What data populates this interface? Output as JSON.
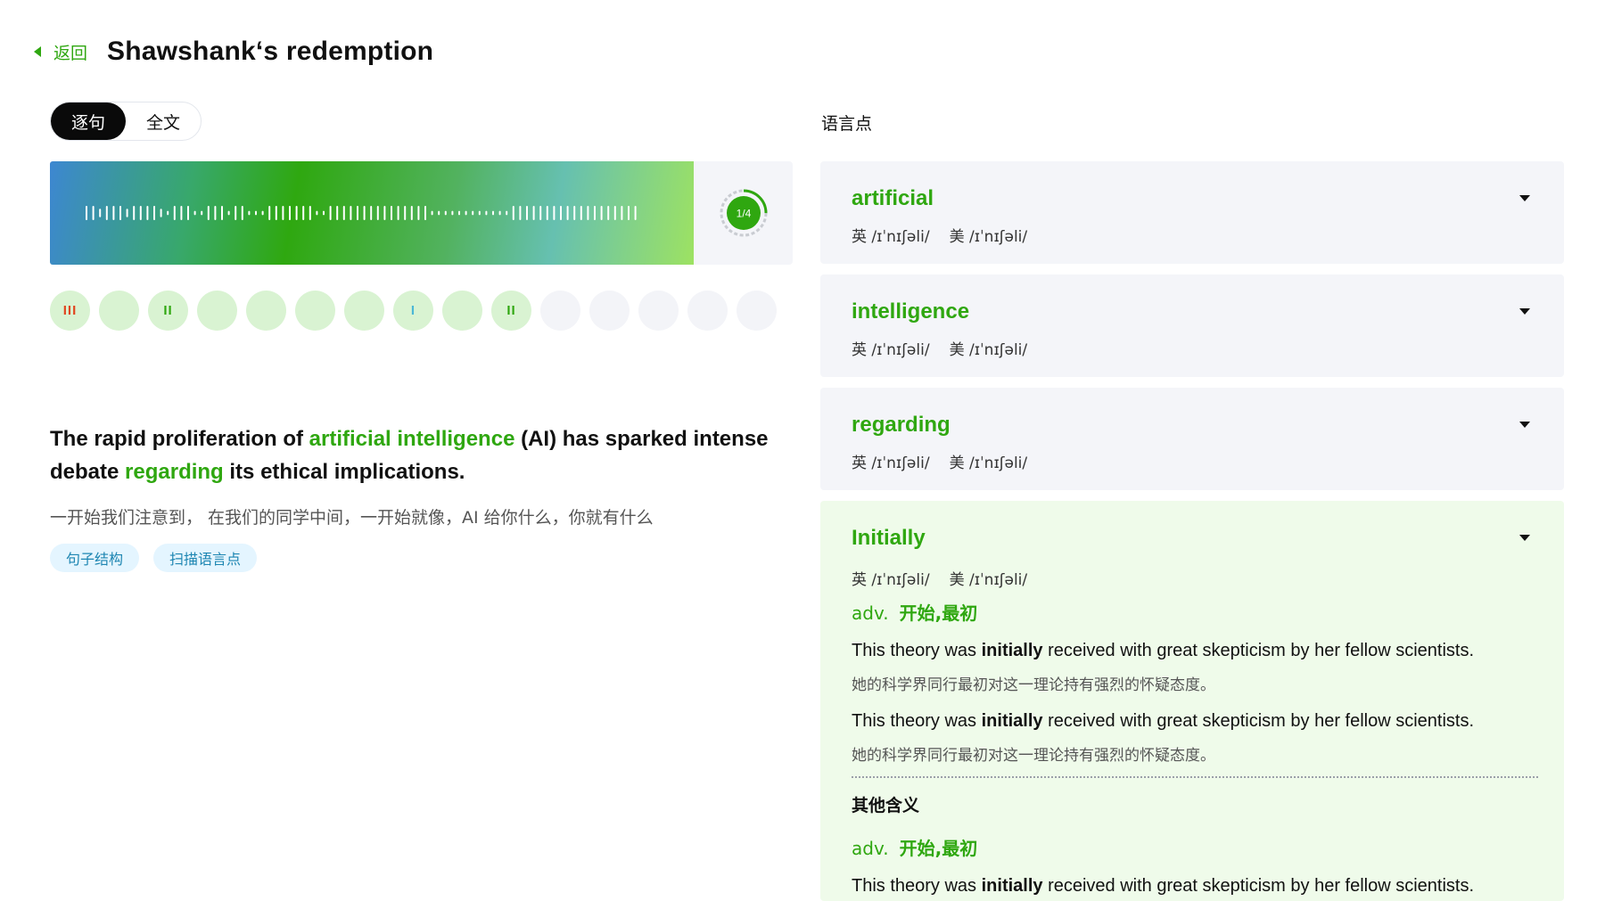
{
  "header": {
    "back_label": "返回",
    "title": "Shawshank‘s redemption"
  },
  "mode_toggle": {
    "options": [
      "逐句",
      "全文"
    ],
    "selected": "逐句"
  },
  "audio": {
    "progress_label": "1/4",
    "progress": 0.25
  },
  "sentence_dots": [
    {
      "state": "filled",
      "mark": "III",
      "color": "#e0451e"
    },
    {
      "state": "filled",
      "mark": "",
      "color": ""
    },
    {
      "state": "filled",
      "mark": "II",
      "color": "#2fa710"
    },
    {
      "state": "filled",
      "mark": "",
      "color": ""
    },
    {
      "state": "filled",
      "mark": "",
      "color": ""
    },
    {
      "state": "filled",
      "mark": "",
      "color": ""
    },
    {
      "state": "filled",
      "mark": "",
      "color": ""
    },
    {
      "state": "filled",
      "mark": "I",
      "color": "#4bb7d6"
    },
    {
      "state": "filled",
      "mark": "",
      "color": ""
    },
    {
      "state": "filled",
      "mark": "II",
      "color": "#2fa710"
    },
    {
      "state": "empty",
      "mark": "",
      "color": ""
    },
    {
      "state": "empty",
      "mark": "",
      "color": ""
    },
    {
      "state": "empty",
      "mark": "",
      "color": ""
    },
    {
      "state": "empty",
      "mark": "",
      "color": ""
    },
    {
      "state": "empty",
      "mark": "",
      "color": ""
    }
  ],
  "sentence": {
    "parts": [
      {
        "text": "The rapid proliferation of ",
        "hl": false
      },
      {
        "text": "artificial intelligence",
        "hl": true
      },
      {
        "text": " (AI) has sparked intense debate ",
        "hl": false
      },
      {
        "text": "regarding",
        "hl": true
      },
      {
        "text": " its ethical implications.",
        "hl": false
      }
    ],
    "translation": "一开始我们注意到， 在我们的同学中间，一开始就像，AI 给你什么，你就有什么"
  },
  "tags": [
    "句子结构",
    "扫描语言点"
  ],
  "language_points": {
    "title": "语言点",
    "items": [
      {
        "word": "artificial",
        "uk": "英 /ɪˈnɪʃəli/",
        "us": "美 /ɪˈnɪʃəli/"
      },
      {
        "word": "intelligence",
        "uk": "英 /ɪˈnɪʃəli/",
        "us": "美 /ɪˈnɪʃəli/"
      },
      {
        "word": "regarding",
        "uk": "英 /ɪˈnɪʃəli/",
        "us": "美 /ɪˈnɪʃəli/"
      },
      {
        "word": "Initially",
        "uk": "英 /ɪˈnɪʃəli/",
        "us": "美 /ɪˈnɪʃəli/",
        "pos": "adv.",
        "meaning": "开始,最初",
        "examples": [
          {
            "en_pre": "This theory was ",
            "en_bold": "initially",
            "en_post": " received with great skepticism by her fellow scientists.",
            "cn": "她的科学界同行最初对这一理论持有强烈的怀疑态度。"
          },
          {
            "en_pre": "This theory was ",
            "en_bold": "initially",
            "en_post": " received with great skepticism by her fellow scientists.",
            "cn": "她的科学界同行最初对这一理论持有强烈的怀疑态度。"
          }
        ],
        "other_title": "其他含义",
        "other_pos": "adv.",
        "other_meaning": "开始,最初",
        "other_example": {
          "en_pre": "This theory was ",
          "en_bold": "initially",
          "en_post": " received with great skepticism by her fellow scientists."
        }
      }
    ]
  },
  "colors": {
    "accent": "#2fa710",
    "tag_bg": "#e4f5ff",
    "tag_text": "#1e86b2",
    "card_bg": "#f4f5f9",
    "expanded_bg": "#effbea"
  }
}
